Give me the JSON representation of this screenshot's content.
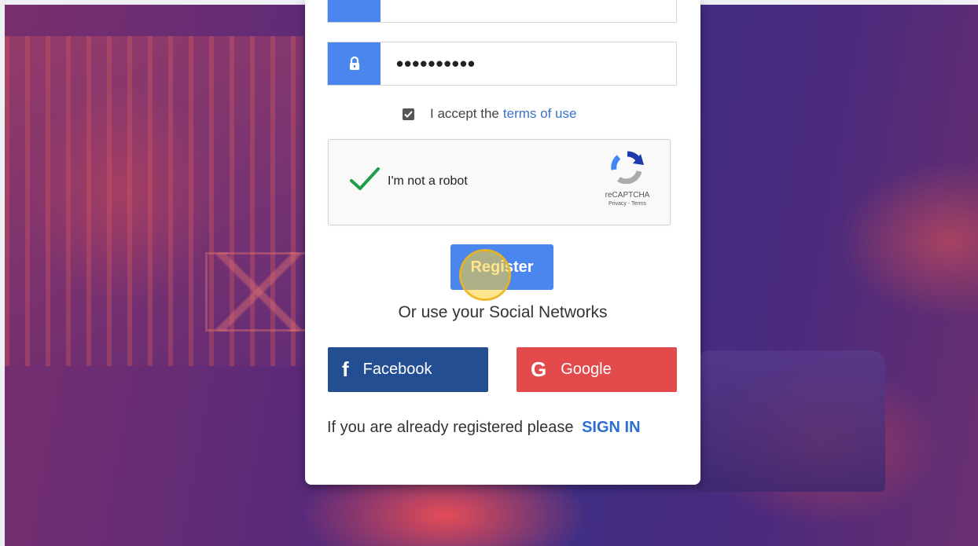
{
  "form": {
    "password_value": "••••••••••",
    "terms_prefix": "I accept the",
    "terms_link": "terms of use",
    "terms_checked": true,
    "register_label": "Register"
  },
  "captcha": {
    "label": "I'm not a robot",
    "brand": "reCAPTCHA",
    "links": "Privacy - Terms",
    "checked": true
  },
  "social": {
    "heading": "Or use your Social Networks",
    "facebook_label": "Facebook",
    "facebook_glyph": "f",
    "google_label": "Google",
    "google_glyph": "G"
  },
  "signin": {
    "prompt": "If you are already registered please",
    "link": "SIGN IN"
  },
  "colors": {
    "accent": "#4a86ee",
    "facebook": "#234e91",
    "google": "#e24a4c",
    "link": "#2d6fd1"
  }
}
